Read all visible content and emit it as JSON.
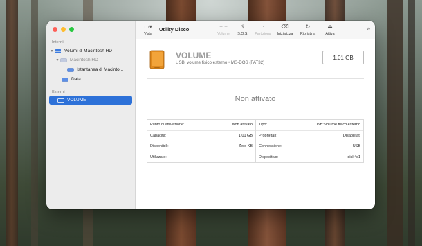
{
  "app": {
    "title": "Utility Disco"
  },
  "toolbar": {
    "buttons": [
      {
        "label": "Vista",
        "icon": "sidebar-icon",
        "disabled": false
      },
      {
        "label": "Volume",
        "icon": "plus-minus-icon",
        "disabled": true
      },
      {
        "label": "S.O.S.",
        "icon": "stethoscope-icon",
        "disabled": false
      },
      {
        "label": "Partiziona",
        "icon": "pie-icon",
        "disabled": true
      },
      {
        "label": "Inizializza",
        "icon": "eraser-icon",
        "disabled": false
      },
      {
        "label": "Ripristina",
        "icon": "restore-icon",
        "disabled": false
      },
      {
        "label": "Attiva",
        "icon": "mount-icon",
        "disabled": false
      }
    ]
  },
  "sidebar": {
    "section_internal": "Interni",
    "section_external": "Esterni",
    "items": [
      {
        "label": "Volumi di Macintosh HD"
      },
      {
        "label": "Macintosh HD"
      },
      {
        "label": "Istantanea di Macinto..."
      },
      {
        "label": "Data"
      },
      {
        "label": "VOLUME"
      }
    ]
  },
  "volume": {
    "name": "VOLUME",
    "description": "USB: volume fisico esterno • MS-DOS (FAT32)",
    "size": "1,01 GB",
    "status": "Non attivato"
  },
  "info": {
    "left": [
      {
        "label": "Punto di attivazione:",
        "value": "Non attivato"
      },
      {
        "label": "Capacità:",
        "value": "1,01 GB"
      },
      {
        "label": "Disponibili:",
        "value": "Zero KB"
      },
      {
        "label": "Utilizzato:",
        "value": "--"
      }
    ],
    "right": [
      {
        "label": "Tipo:",
        "value": "USB: volume fisico esterno"
      },
      {
        "label": "Proprietari:",
        "value": "Disabilitati"
      },
      {
        "label": "Connessione:",
        "value": "USB"
      },
      {
        "label": "Dispositivo:",
        "value": "disk4s1"
      }
    ]
  },
  "colors": {
    "accent": "#2d71d8",
    "volume_icon": "#e08a1e"
  }
}
